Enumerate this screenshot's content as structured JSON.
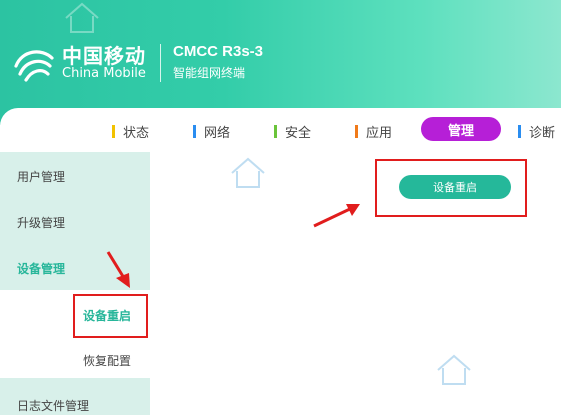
{
  "brand": {
    "name_cn": "中国移动",
    "name_en": "China Mobile",
    "model": "CMCC R3s-3",
    "subtitle": "智能组网终端"
  },
  "nav": {
    "items": [
      {
        "label": "状态",
        "color": "#f2c200"
      },
      {
        "label": "网络",
        "color": "#2a8df0"
      },
      {
        "label": "安全",
        "color": "#6ac43a"
      },
      {
        "label": "应用",
        "color": "#f07a1a"
      },
      {
        "label": "管理",
        "color": "#b61fd7"
      },
      {
        "label": "诊断",
        "color": "#2a8df0"
      }
    ],
    "active": "管理"
  },
  "sidebar": {
    "items": [
      "用户管理",
      "升级管理",
      "设备管理",
      "日志文件管理"
    ],
    "sub_items": [
      "设备重启",
      "恢复配置"
    ]
  },
  "main": {
    "reboot_button": "设备重启"
  },
  "colors": {
    "accent": "#25b89a",
    "active_nav": "#b61fd7",
    "annotation": "#e11d1d"
  }
}
